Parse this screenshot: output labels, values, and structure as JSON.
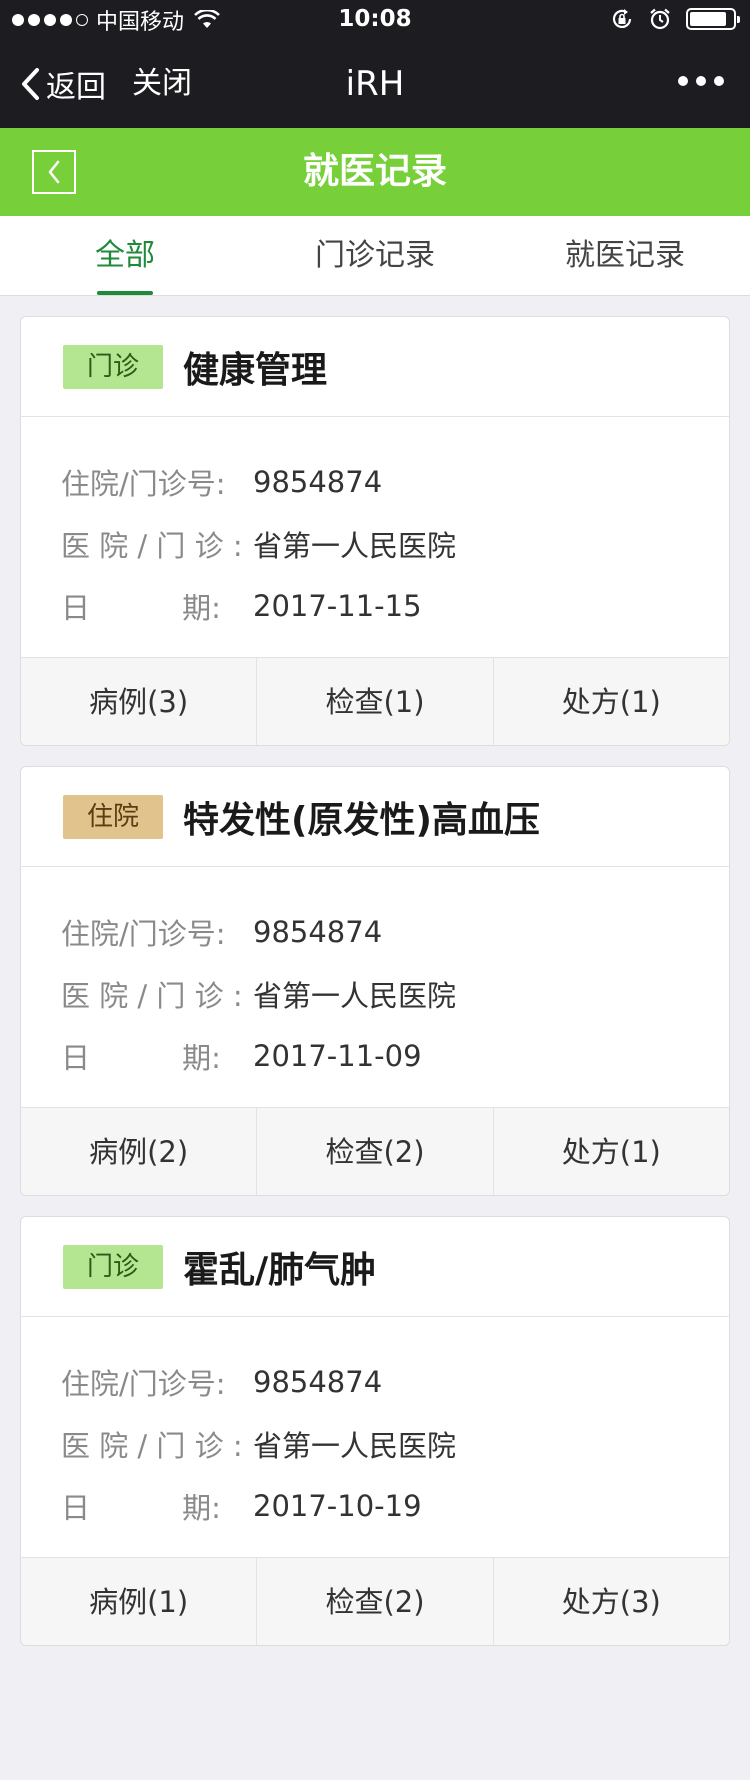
{
  "status_bar": {
    "carrier": "中国移动",
    "time": "10:08",
    "signal_strength": 4,
    "signal_max": 5,
    "battery_level": 0.85,
    "icons": [
      "wifi-icon",
      "rotation-lock-icon",
      "alarm-icon",
      "battery-icon"
    ]
  },
  "wechat_nav": {
    "back_label": "返回",
    "close_label": "关闭",
    "title": "iRH",
    "more_icon": "more-dots-icon"
  },
  "header": {
    "title": "就医记录",
    "back_icon": "chevron-left-icon",
    "color": "#77cf3a"
  },
  "tabs": [
    {
      "label": "全部",
      "active": true
    },
    {
      "label": "门诊记录",
      "active": false
    },
    {
      "label": "就医记录",
      "active": false
    }
  ],
  "labels": {
    "record_no": "住院/门诊号:",
    "hospital": "医 院 / 门 诊 :",
    "date": "日          期:"
  },
  "records": [
    {
      "type": "门诊",
      "type_color": "#b4e692",
      "title": "健康管理",
      "record_no": "9854874",
      "hospital": "省第一人民医院",
      "date": "2017-11-15",
      "actions": [
        "病例(3)",
        "检查(1)",
        "处方(1)"
      ]
    },
    {
      "type": "住院",
      "type_color": "#e1c38d",
      "title": "特发性(原发性)高血压",
      "record_no": "9854874",
      "hospital": "省第一人民医院",
      "date": "2017-11-09",
      "actions": [
        "病例(2)",
        "检查(2)",
        "处方(1)"
      ]
    },
    {
      "type": "门诊",
      "type_color": "#b4e692",
      "title": "霍乱/肺气肿",
      "record_no": "9854874",
      "hospital": "省第一人民医院",
      "date": "2017-10-19",
      "actions": [
        "病例(1)",
        "检查(2)",
        "处方(3)"
      ]
    }
  ]
}
